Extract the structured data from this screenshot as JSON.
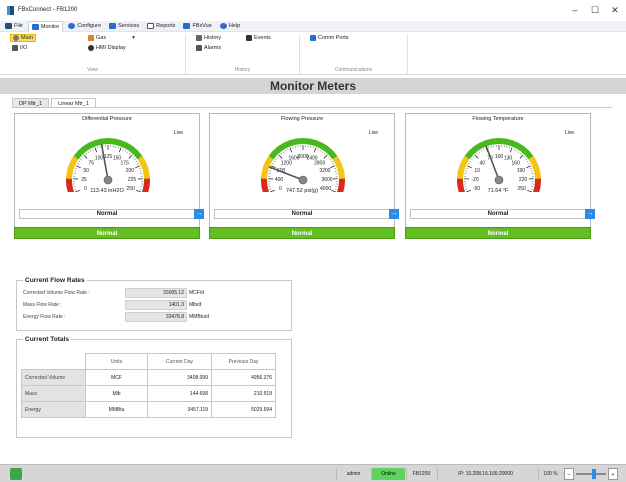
{
  "window": {
    "title": "FBxConnect - FB1200",
    "minimize": "–",
    "maximize": "☐",
    "close": "✕"
  },
  "menu": {
    "items": [
      {
        "label": "File",
        "color": "#1f4e79"
      },
      {
        "label": "Monitor",
        "color": "#2a6bd1"
      },
      {
        "label": "Configure",
        "color": "#2a6bd1"
      },
      {
        "label": "Services",
        "color": "#2a6bd1"
      },
      {
        "label": "Reports",
        "color": "#555555"
      },
      {
        "label": "FBxVue",
        "color": "#2a6bd1"
      },
      {
        "label": "Help",
        "color": "#2a6bd1"
      }
    ]
  },
  "ribbon": {
    "view_group": "View",
    "history_group": "History",
    "comm_group": "Communications",
    "main": "Main",
    "io": "I/O",
    "gas": "Gas",
    "gas_arrow": "▾",
    "hmi": "HMI Display",
    "history": "History",
    "alarms": "Alarms",
    "events": "Events",
    "comm_ports": "Comm Ports"
  },
  "page_title": "Monitor Meters",
  "tabs": [
    "DP Mtr_1",
    "Linear Mtr_1"
  ],
  "gauges": [
    {
      "title": "Differential Pressure",
      "live": "Live",
      "value_text": "113.43",
      "unit": "inH2O",
      "status": "Normal",
      "bar": "Normal",
      "ticks": [
        "0",
        "25",
        "50",
        "75",
        "100",
        "125",
        "150",
        "175",
        "200",
        "225",
        "250"
      ],
      "min": 0,
      "max": 250,
      "value": 113.43
    },
    {
      "title": "Flowing Pressure",
      "live": "Live",
      "value_text": "747.52",
      "unit": "psi(g)",
      "status": "Normal",
      "bar": "Normal",
      "ticks": [
        "0",
        "400",
        "800",
        "1200",
        "1600",
        "2000",
        "2400",
        "2800",
        "3200",
        "3600",
        "4000"
      ],
      "min": 0,
      "max": 4000,
      "value": 747.52
    },
    {
      "title": "Flowing Temperature",
      "live": "Live",
      "value_text": "71.64",
      "unit": "°F",
      "status": "Normal",
      "bar": "Normal",
      "ticks": [
        "-50",
        "-20",
        "10",
        "40",
        "70",
        "100",
        "130",
        "160",
        "190",
        "220",
        "250"
      ],
      "min": -50,
      "max": 250,
      "value": 71.64
    }
  ],
  "flow": {
    "legend": "Current Flow Rates",
    "rows": [
      {
        "label": "Corrected Volume Flow Rate :",
        "value": "33005.12",
        "unit": "MCF/d"
      },
      {
        "label": "Mass Flow Rate :",
        "value": "1401.3",
        "unit": "Mlb/d"
      },
      {
        "label": "Energy Flow Rate :",
        "value": "33478.8",
        "unit": "MMBtu/d"
      }
    ]
  },
  "totals": {
    "legend": "Current Totals",
    "headers": [
      "Units",
      "Current Day",
      "Previous Day"
    ],
    "rows": [
      {
        "label": "Corrected Volume",
        "units": "MCF",
        "current": "3408.099",
        "previous": "4956.376"
      },
      {
        "label": "Mass",
        "units": "Mlb",
        "current": "144.698",
        "previous": "210.518"
      },
      {
        "label": "Energy",
        "units": "MMBtu",
        "current": "3457.119",
        "previous": "5029.694"
      }
    ]
  },
  "statusbar": {
    "user": "admin",
    "state": "Online",
    "device": "FB1200",
    "ip": "IP: 10.208.15.166:20000",
    "zoom": "100 %",
    "zoom_minus": "–",
    "zoom_plus": "+",
    "zoom_level_pct": 60
  },
  "colors": {
    "accent": "#2b8be6",
    "normal_green": "#63be21",
    "online": "#5fd35f",
    "header_gray": "#d4d4d4"
  }
}
